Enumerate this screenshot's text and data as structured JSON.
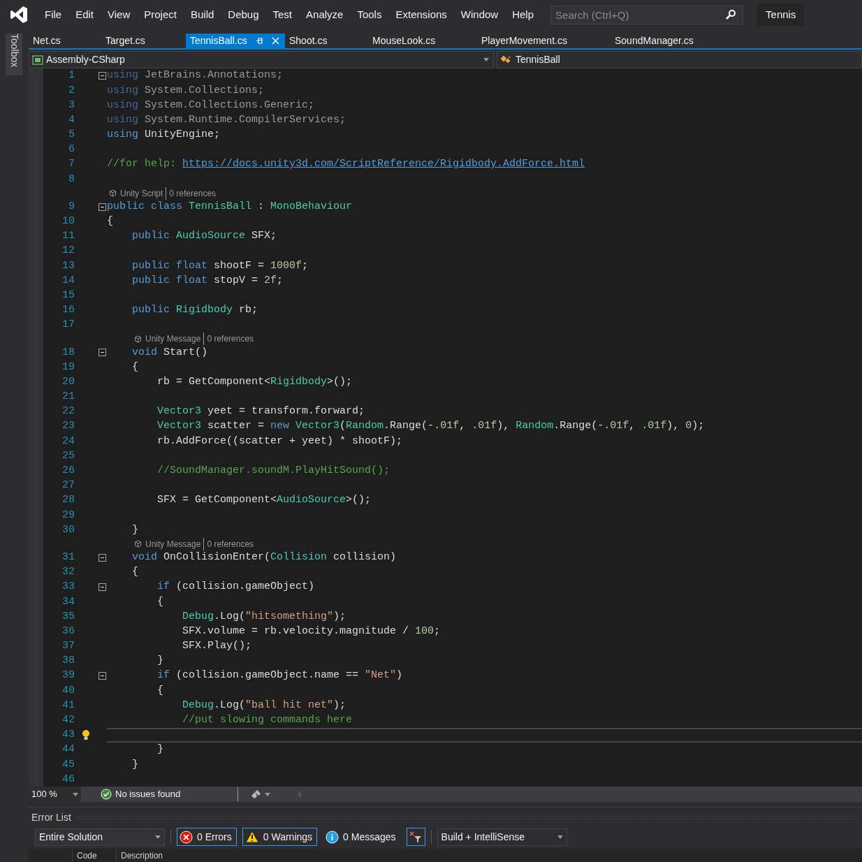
{
  "menu": [
    "File",
    "Edit",
    "View",
    "Project",
    "Build",
    "Debug",
    "Test",
    "Analyze",
    "Tools",
    "Extensions",
    "Window",
    "Help"
  ],
  "search": {
    "placeholder": "Search (Ctrl+Q)"
  },
  "solution_name": "Tennis",
  "toolbox_label": "Toolbox",
  "tabs": [
    {
      "label": "Net.cs",
      "selected": false
    },
    {
      "label": "Target.cs",
      "selected": false
    },
    {
      "label": "TennisBall.cs",
      "selected": true
    },
    {
      "label": "Shoot.cs",
      "selected": false
    },
    {
      "label": "MouseLook.cs",
      "selected": false
    },
    {
      "label": "PlayerMovement.cs",
      "selected": false
    },
    {
      "label": "SoundManager.cs",
      "selected": false
    }
  ],
  "navigation": {
    "project": "Assembly-CSharp",
    "class": "TennisBall"
  },
  "editor": {
    "lines": [
      {
        "number": "1",
        "fold": true,
        "current": false,
        "tokens": [
          {
            "kind": "unused-keyword",
            "text": "using"
          },
          {
            "kind": "unused",
            "text": " JetBrains.Annotations;"
          }
        ]
      },
      {
        "number": "2",
        "fold": false,
        "current": false,
        "tokens": [
          {
            "kind": "unused-keyword",
            "text": "using"
          },
          {
            "kind": "unused",
            "text": " System.Collections;"
          }
        ]
      },
      {
        "number": "3",
        "fold": false,
        "current": false,
        "tokens": [
          {
            "kind": "unused-keyword",
            "text": "using"
          },
          {
            "kind": "unused",
            "text": " System.Collections.Generic;"
          }
        ]
      },
      {
        "number": "4",
        "fold": false,
        "current": false,
        "tokens": [
          {
            "kind": "unused-keyword",
            "text": "using"
          },
          {
            "kind": "unused",
            "text": " System.Runtime.CompilerServices;"
          }
        ]
      },
      {
        "number": "5",
        "fold": false,
        "current": false,
        "tokens": [
          {
            "kind": "keyword",
            "text": "using"
          },
          {
            "kind": "plain",
            "text": " UnityEngine;"
          }
        ]
      },
      {
        "number": "6",
        "fold": false,
        "current": false
      },
      {
        "number": "7",
        "fold": false,
        "current": false,
        "tokens": [
          {
            "kind": "comment",
            "text": "//for help:"
          },
          {
            "kind": "link",
            "text": "https://docs.unity3d.com/ScriptReference/Rigidbody.AddForce.html"
          }
        ]
      },
      {
        "number": "8",
        "fold": false,
        "current": false
      },
      {
        "number": "9",
        "fold": true,
        "current": false,
        "lens": {
          "label": "Unity Script",
          "references": "0 references"
        },
        "tokens": [
          {
            "kind": "keyword",
            "text": "public"
          },
          {
            "kind": "keyword",
            "text": " class"
          },
          {
            "kind": "type",
            "text": " TennisBall"
          },
          {
            "kind": "plain",
            "text": " :"
          },
          {
            "kind": "type",
            "text": " MonoBehaviour"
          }
        ]
      },
      {
        "number": "10",
        "fold": false,
        "current": false,
        "tokens": [
          {
            "kind": "plain",
            "text": "{"
          }
        ]
      },
      {
        "number": "11",
        "fold": false,
        "current": false,
        "tokens": [
          {
            "kind": "keyword",
            "text": "    public"
          },
          {
            "kind": "type",
            "text": " AudioSource"
          },
          {
            "kind": "plain",
            "text": " SFX;"
          }
        ]
      },
      {
        "number": "12",
        "fold": false,
        "current": false
      },
      {
        "number": "13",
        "fold": false,
        "current": false,
        "tokens": [
          {
            "kind": "keyword",
            "text": "    public"
          },
          {
            "kind": "keyword",
            "text": " float"
          },
          {
            "kind": "plain",
            "text": " shootF ="
          },
          {
            "kind": "number",
            "text": " 1000f"
          },
          {
            "kind": "plain",
            "text": ";"
          }
        ]
      },
      {
        "number": "14",
        "fold": false,
        "current": false,
        "tokens": [
          {
            "kind": "keyword",
            "text": "    public"
          },
          {
            "kind": "keyword",
            "text": " float"
          },
          {
            "kind": "plain",
            "text": " stopV ="
          },
          {
            "kind": "number",
            "text": " 2f"
          },
          {
            "kind": "plain",
            "text": ";"
          }
        ]
      },
      {
        "number": "15",
        "fold": false,
        "current": false
      },
      {
        "number": "16",
        "fold": false,
        "current": false,
        "tokens": [
          {
            "kind": "keyword",
            "text": "    public"
          },
          {
            "kind": "type",
            "text": " Rigidbody"
          },
          {
            "kind": "plain",
            "text": " rb;"
          }
        ]
      },
      {
        "number": "17",
        "fold": false,
        "current": false
      },
      {
        "number": "18",
        "fold": true,
        "current": false,
        "lens": {
          "label": "Unity Message",
          "references": "0 references"
        },
        "tokens": [
          {
            "kind": "keyword",
            "text": "    void"
          },
          {
            "kind": "plain",
            "text": " Start()"
          }
        ]
      },
      {
        "number": "19",
        "fold": false,
        "current": false,
        "tokens": [
          {
            "kind": "plain",
            "text": "    {"
          }
        ]
      },
      {
        "number": "20",
        "fold": false,
        "current": false,
        "tokens": [
          {
            "kind": "plain",
            "text": "        rb = GetComponent<"
          },
          {
            "kind": "type",
            "text": "Rigidbody"
          },
          {
            "kind": "plain",
            "text": ">();"
          }
        ]
      },
      {
        "number": "21",
        "fold": false,
        "current": false
      },
      {
        "number": "22",
        "fold": false,
        "current": false,
        "tokens": [
          {
            "kind": "type",
            "text": "        Vector3"
          },
          {
            "kind": "plain",
            "text": " yeet = transform.forward;"
          }
        ]
      },
      {
        "number": "23",
        "fold": false,
        "current": false,
        "tokens": [
          {
            "kind": "type",
            "text": "        Vector3"
          },
          {
            "kind": "plain",
            "text": " scatter ="
          },
          {
            "kind": "keyword",
            "text": " new"
          },
          {
            "kind": "type",
            "text": " Vector3"
          },
          {
            "kind": "plain",
            "text": "("
          },
          {
            "kind": "type",
            "text": "Random"
          },
          {
            "kind": "plain",
            "text": ".Range(-"
          },
          {
            "kind": "number",
            "text": ".01f"
          },
          {
            "kind": "plain",
            "text": ","
          },
          {
            "kind": "number",
            "text": " .01f"
          },
          {
            "kind": "plain",
            "text": "),"
          },
          {
            "kind": "type",
            "text": " Random"
          },
          {
            "kind": "plain",
            "text": ".Range(-"
          },
          {
            "kind": "number",
            "text": ".01f"
          },
          {
            "kind": "plain",
            "text": ","
          },
          {
            "kind": "number",
            "text": " .01f"
          },
          {
            "kind": "plain",
            "text": "),"
          },
          {
            "kind": "number",
            "text": " 0"
          },
          {
            "kind": "plain",
            "text": ");"
          }
        ]
      },
      {
        "number": "24",
        "fold": false,
        "current": false,
        "tokens": [
          {
            "kind": "plain",
            "text": "        rb.AddForce((scatter + yeet) * shootF);"
          }
        ]
      },
      {
        "number": "25",
        "fold": false,
        "current": false
      },
      {
        "number": "26",
        "fold": false,
        "current": false,
        "tokens": [
          {
            "kind": "comment",
            "text": "        //SoundManager.soundM.PlayHitSound();"
          }
        ]
      },
      {
        "number": "27",
        "fold": false,
        "current": false
      },
      {
        "number": "28",
        "fold": false,
        "current": false,
        "tokens": [
          {
            "kind": "plain",
            "text": "        SFX = GetComponent<"
          },
          {
            "kind": "type",
            "text": "AudioSource"
          },
          {
            "kind": "plain",
            "text": ">();"
          }
        ]
      },
      {
        "number": "29",
        "fold": false,
        "current": false
      },
      {
        "number": "30",
        "fold": false,
        "current": false,
        "tokens": [
          {
            "kind": "plain",
            "text": "    }"
          }
        ]
      },
      {
        "number": "31",
        "fold": true,
        "current": false,
        "lens": {
          "label": "Unity Message",
          "references": "0 references"
        },
        "tokens": [
          {
            "kind": "keyword",
            "text": "    void"
          },
          {
            "kind": "plain",
            "text": " OnCollisionEnter("
          },
          {
            "kind": "type",
            "text": "Collision"
          },
          {
            "kind": "plain",
            "text": " collision)"
          }
        ]
      },
      {
        "number": "32",
        "fold": false,
        "current": false,
        "tokens": [
          {
            "kind": "plain",
            "text": "    {"
          }
        ]
      },
      {
        "number": "33",
        "fold": true,
        "current": false,
        "tokens": [
          {
            "kind": "keyword",
            "text": "        if"
          },
          {
            "kind": "plain",
            "text": " (collision.gameObject)"
          }
        ]
      },
      {
        "number": "34",
        "fold": false,
        "current": false,
        "tokens": [
          {
            "kind": "plain",
            "text": "        {"
          }
        ]
      },
      {
        "number": "35",
        "fold": false,
        "current": false,
        "tokens": [
          {
            "kind": "type",
            "text": "            Debug"
          },
          {
            "kind": "plain",
            "text": ".Log("
          },
          {
            "kind": "string",
            "text": "\"hitsomething\""
          },
          {
            "kind": "plain",
            "text": ");"
          }
        ]
      },
      {
        "number": "36",
        "fold": false,
        "current": false,
        "tokens": [
          {
            "kind": "plain",
            "text": "            SFX.volume = rb.velocity.magnitude /"
          },
          {
            "kind": "number",
            "text": " 100"
          },
          {
            "kind": "plain",
            "text": ";"
          }
        ]
      },
      {
        "number": "37",
        "fold": false,
        "current": false,
        "tokens": [
          {
            "kind": "plain",
            "text": "            SFX.Play();"
          }
        ]
      },
      {
        "number": "38",
        "fold": false,
        "current": false,
        "tokens": [
          {
            "kind": "plain",
            "text": "        }"
          }
        ]
      },
      {
        "number": "39",
        "fold": true,
        "current": false,
        "tokens": [
          {
            "kind": "keyword",
            "text": "        if"
          },
          {
            "kind": "plain",
            "text": " (collision.gameObject.name =="
          },
          {
            "kind": "string",
            "text": " \"Net\""
          },
          {
            "kind": "plain",
            "text": ")"
          }
        ]
      },
      {
        "number": "40",
        "fold": false,
        "current": false,
        "tokens": [
          {
            "kind": "plain",
            "text": "        {"
          }
        ]
      },
      {
        "number": "41",
        "fold": false,
        "current": false,
        "tokens": [
          {
            "kind": "type",
            "text": "            Debug"
          },
          {
            "kind": "plain",
            "text": ".Log("
          },
          {
            "kind": "string",
            "text": "\"ball hit net\""
          },
          {
            "kind": "plain",
            "text": ");"
          }
        ]
      },
      {
        "number": "42",
        "fold": false,
        "current": false,
        "tokens": [
          {
            "kind": "comment",
            "text": "            //put slowing commands here"
          }
        ]
      },
      {
        "number": "43",
        "fold": false,
        "current": true
      },
      {
        "number": "44",
        "fold": false,
        "current": false,
        "tokens": [
          {
            "kind": "plain",
            "text": "        }"
          }
        ]
      },
      {
        "number": "45",
        "fold": false,
        "current": false,
        "tokens": [
          {
            "kind": "plain",
            "text": "    }"
          }
        ]
      },
      {
        "number": "46",
        "fold": false,
        "current": false
      }
    ]
  },
  "status_bar": {
    "zoom": "100 %",
    "issues": "No issues found"
  },
  "error_list": {
    "title": "Error List",
    "scope": "Entire Solution",
    "filters": [
      {
        "kind": "error",
        "label": "0 Errors",
        "on": true
      },
      {
        "kind": "warning",
        "label": "0 Warnings",
        "on": true
      },
      {
        "kind": "message",
        "label": "0 Messages",
        "on": false
      }
    ],
    "source": "Build + IntelliSense",
    "columns": [
      "Code",
      "Description"
    ]
  }
}
